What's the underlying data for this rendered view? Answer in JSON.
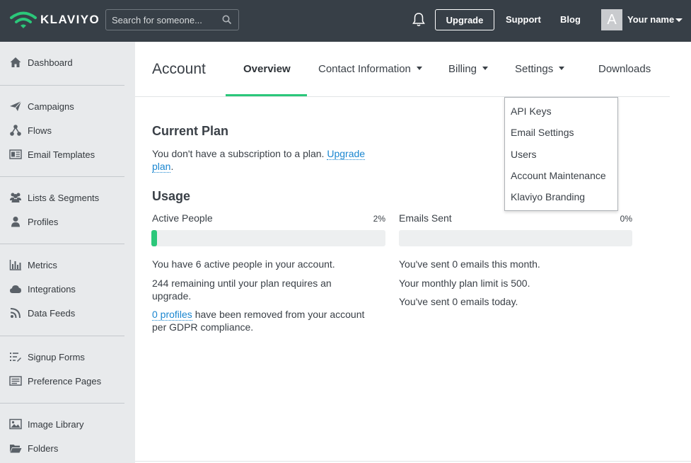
{
  "topbar": {
    "brand": "KLAVIYO",
    "search_placeholder": "Search for someone...",
    "upgrade_label": "Upgrade",
    "support_label": "Support",
    "blog_label": "Blog",
    "avatar_initial": "A",
    "user_name": "Your name"
  },
  "sidebar": {
    "items": [
      {
        "label": "Dashboard",
        "icon": "home-icon"
      },
      {
        "label": "Campaigns",
        "icon": "paper-plane-icon"
      },
      {
        "label": "Flows",
        "icon": "flows-icon"
      },
      {
        "label": "Email Templates",
        "icon": "email-template-icon"
      },
      {
        "label": "Lists & Segments",
        "icon": "users-icon"
      },
      {
        "label": "Profiles",
        "icon": "user-icon"
      },
      {
        "label": "Metrics",
        "icon": "bar-chart-icon"
      },
      {
        "label": "Integrations",
        "icon": "cloud-icon"
      },
      {
        "label": "Data Feeds",
        "icon": "rss-icon"
      },
      {
        "label": "Signup Forms",
        "icon": "list-edit-icon"
      },
      {
        "label": "Preference Pages",
        "icon": "preference-page-icon"
      },
      {
        "label": "Image Library",
        "icon": "image-icon"
      },
      {
        "label": "Folders",
        "icon": "folder-icon"
      }
    ]
  },
  "main": {
    "title": "Account",
    "tabs": [
      {
        "label": "Overview",
        "active": true
      },
      {
        "label": "Contact Information",
        "dropdown": true
      },
      {
        "label": "Billing",
        "dropdown": true
      },
      {
        "label": "Settings",
        "dropdown": true
      },
      {
        "label": "Downloads"
      }
    ],
    "current_plan": {
      "heading": "Current Plan",
      "text": "You don't have a subscription to a plan.",
      "link_part1": "Upgrade",
      "link_part2": "plan",
      "suffix": "."
    },
    "usage": {
      "heading": "Usage",
      "active_people": {
        "label": "Active People",
        "percent_text": "2%",
        "fill_fraction": 0.02,
        "line1": "You have 6 active people in your account.",
        "line2a": "244 remaining until your plan requires an",
        "line2b": "upgrade.",
        "profiles_link": "0 profiles",
        "line3a_rest": "have been removed from your account",
        "line3b": "per GDPR compliance."
      },
      "emails_sent": {
        "label": "Emails Sent",
        "percent_text": "0%",
        "fill_fraction": 0,
        "line1": "You've sent 0 emails this month.",
        "line2": "Your monthly plan limit is 500.",
        "line3": "You've sent 0 emails today."
      }
    }
  },
  "settings_dropdown": {
    "items": [
      "API Keys",
      "Email Settings",
      "Users",
      "Account Maintenance",
      "Klaviyo Branding"
    ]
  },
  "colors": {
    "topbar": "#373f47",
    "sidebar": "#e8eaec",
    "accent_green": "#2bc77a",
    "link_blue": "#1a86d0"
  }
}
